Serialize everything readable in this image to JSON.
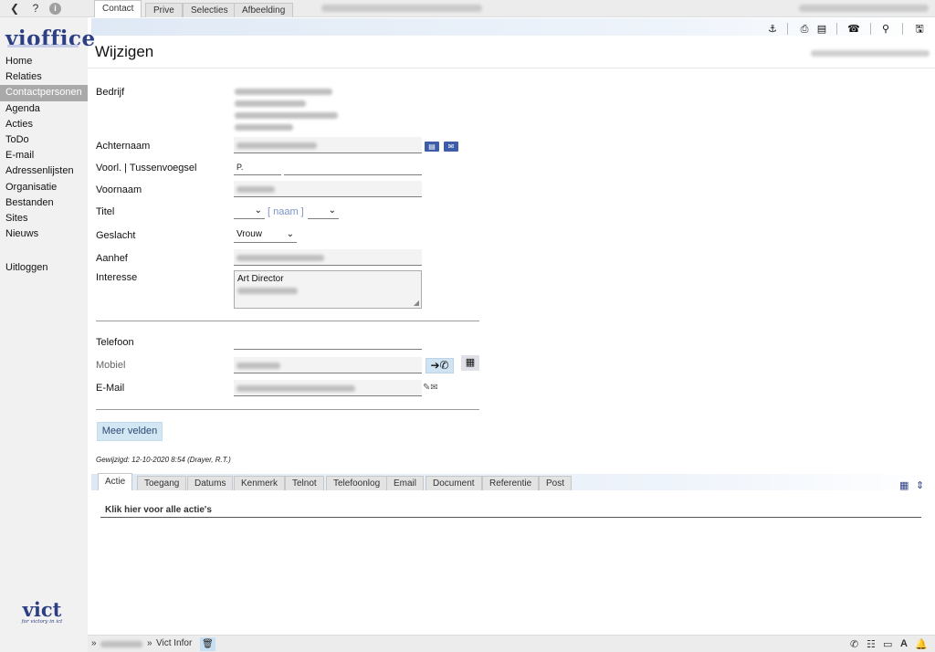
{
  "topbar": {
    "back_icon": "chevron-left-icon",
    "help_glyph": "?",
    "info_glyph": "i"
  },
  "sidebar": {
    "logo": "vioffice",
    "items": [
      {
        "label": "Home"
      },
      {
        "label": "Relaties"
      },
      {
        "label": "Contactpersonen",
        "active": true
      },
      {
        "label": "Agenda"
      },
      {
        "label": "Acties"
      },
      {
        "label": "ToDo"
      },
      {
        "label": "E-mail"
      },
      {
        "label": "Adressenlijsten"
      },
      {
        "label": "Organisatie"
      },
      {
        "label": "Bestanden"
      },
      {
        "label": "Sites"
      },
      {
        "label": "Nieuws"
      }
    ],
    "logout": "Uitloggen",
    "bottom_logo": "vict",
    "bottom_logo_tagline": "for victory in ict"
  },
  "tabs": [
    {
      "label": "Contact"
    },
    {
      "label": "Prive"
    },
    {
      "label": "Selecties"
    },
    {
      "label": "Afbeelding"
    }
  ],
  "toolbar_icons": [
    "anchor-icon",
    "print-icon",
    "list-icon",
    "phone-icon",
    "search-icon",
    "save-icon"
  ],
  "page": {
    "title": "Wijzigen"
  },
  "form": {
    "bedrijf_label": "Bedrijf",
    "achternaam_label": "Achternaam",
    "voorl_label": "Voorl. | Tussenvoegsel",
    "voorl_value": "P.",
    "voornaam_label": "Voornaam",
    "titel_label": "Titel",
    "naam_hint": "[ naam ]",
    "geslacht_label": "Geslacht",
    "geslacht_value": "Vrouw",
    "aanhef_label": "Aanhef",
    "interesse_label": "Interesse",
    "interesse_value": "Art Director",
    "telefoon_label": "Telefoon",
    "mobiel_label": "Mobiel",
    "email_label": "E-Mail",
    "more_fields": "Meer velden",
    "changed": "Gewijzigd: 12-10-2020 8:54 (Drayer, R.T.)"
  },
  "bottom_tabs": [
    {
      "label": "Actie"
    },
    {
      "label": "Toegang"
    },
    {
      "label": "Datums"
    },
    {
      "label": "Kenmerk"
    },
    {
      "label": "Telnot"
    },
    {
      "label": "Telefoonlog"
    },
    {
      "label": "Email"
    },
    {
      "label": "Document"
    },
    {
      "label": "Referentie"
    },
    {
      "label": "Post"
    }
  ],
  "actions_link": "Klik hier voor alle actie's",
  "footer": {
    "sep": "»",
    "app": "Vict Infor",
    "status_icons": [
      "phone-icon",
      "list-icon",
      "monitor-icon",
      "font-icon",
      "bell-icon"
    ]
  }
}
